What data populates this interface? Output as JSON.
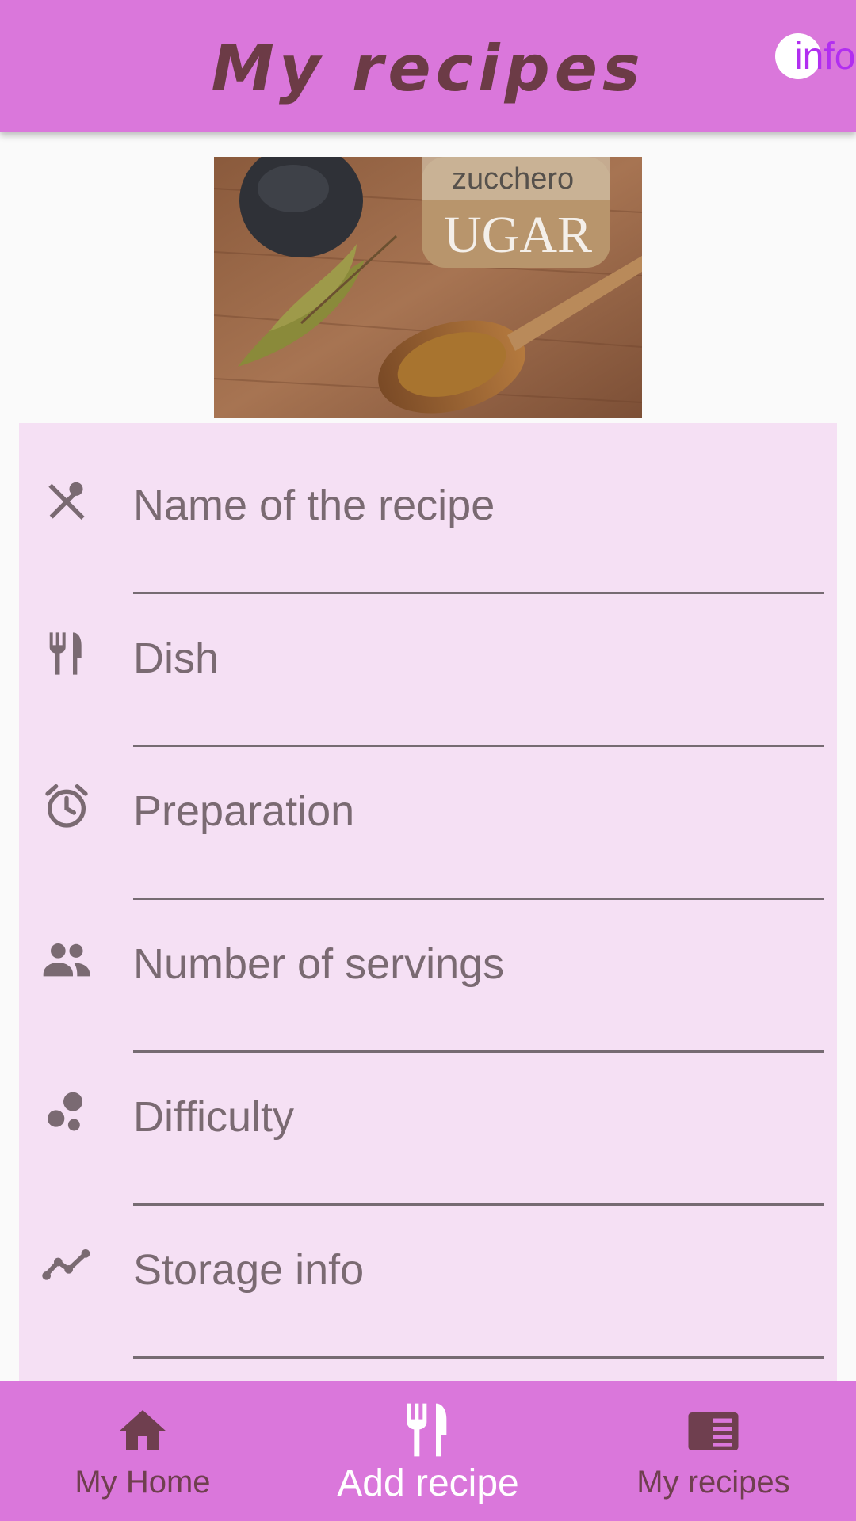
{
  "app_bar": {
    "title": "My recipes",
    "info_label": "info"
  },
  "hero_image": {
    "alt": "avocado, sugar jar, bay leaves and wooden spoon"
  },
  "form": {
    "fields": [
      {
        "label": "Name of the recipe",
        "icon": "spoon-knife-icon"
      },
      {
        "label": "Dish",
        "icon": "restaurant-icon"
      },
      {
        "label": "Preparation",
        "icon": "alarm-clock-icon"
      },
      {
        "label": "Number of servings",
        "icon": "people-icon"
      },
      {
        "label": "Difficulty",
        "icon": "bubbles-icon"
      },
      {
        "label": "Storage info",
        "icon": "trending-line-icon"
      }
    ]
  },
  "bottom_nav": {
    "items": [
      {
        "label": "My Home",
        "icon": "home-icon",
        "active": false
      },
      {
        "label": "Add recipe",
        "icon": "restaurant-icon",
        "active": true
      },
      {
        "label": "My recipes",
        "icon": "book-icon",
        "active": false
      }
    ]
  },
  "colors": {
    "primary": "#da77db",
    "form_background": "#f5e0f4",
    "title_text": "#6c3b46",
    "info_text": "#b12ff0",
    "field_text": "#7a6a72"
  }
}
